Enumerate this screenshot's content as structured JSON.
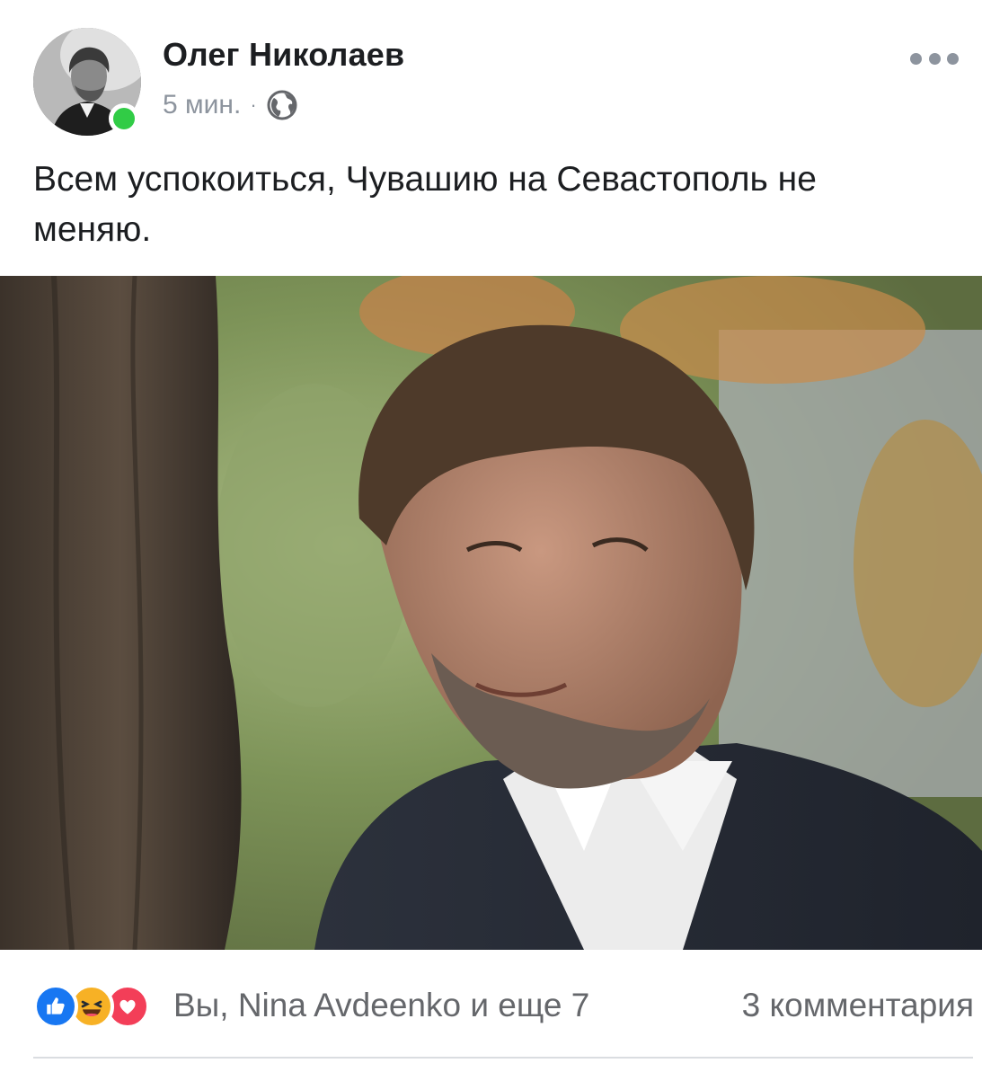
{
  "post": {
    "author_name": "Олег Николаев",
    "timestamp": "5 мин.",
    "separator": "·",
    "privacy_icon": "globe-icon",
    "online": true,
    "text": "Всем успокоиться, Чувашию на Севастополь не меняю.",
    "photo_description": "portrait photo",
    "reactions": {
      "icons": [
        "like-icon",
        "haha-icon",
        "love-icon"
      ],
      "summary": "Вы, Nina Avdeenko и еще 7"
    },
    "comments_count": "3 комментария"
  },
  "colors": {
    "online": "#31cc46",
    "like": "#1877f2",
    "haha": "#f7b125",
    "love": "#f33e58",
    "secondary_text": "#8d949e"
  }
}
